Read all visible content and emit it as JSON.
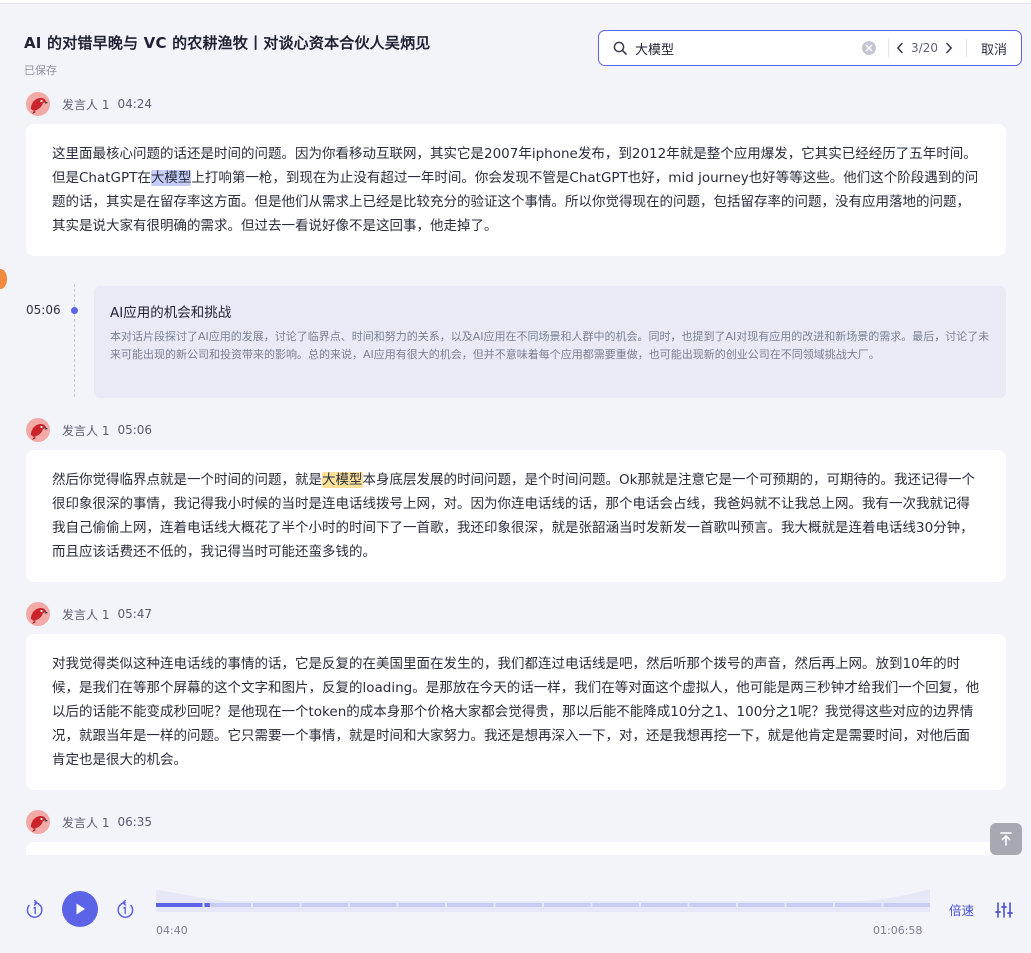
{
  "header": {
    "title": "AI 的对错早晚与 VC 的农耕渔牧丨对谈心资本合伙人吴炳见",
    "saved": "已保存"
  },
  "search": {
    "query": "大模型",
    "counter": "3/20",
    "cancel": "取消"
  },
  "segments": [
    {
      "speaker": "发言人 1",
      "time": "04:24",
      "before": "这里面最核心问题的话还是时间的问题。因为你看移动互联网，其实它是2007年iphone发布，到2012年就是整个应用爆发，它其实已经经历了五年时间。但是ChatGPT在",
      "highlight": "大模型",
      "after": "上打响第一枪，到现在为止没有超过一年时间。你会发现不管是ChatGPT也好，mid journey也好等等这些。他们这个阶段遇到的问题的话，其实是在留存率这方面。但是他们从需求上已经是比较充分的验证这个事情。所以你觉得现在的问题，包括留存率的问题，没有应用落地的问题，其实是说大家有很明确的需求。但过去一看说好像不是这回事，他走掉了。"
    },
    {
      "speaker": "发言人 1",
      "time": "05:06",
      "before": "然后你觉得临界点就是一个时间的问题，就是",
      "highlight": "大模型",
      "after": "本身底层发展的时间问题，是个时间问题。Ok那就是注意它是一个可预期的，可期待的。我还记得一个很印象很深的事情，我记得我小时候的当时是连电话线拨号上网，对。因为你连电话线的话，那个电话会占线，我爸妈就不让我总上网。我有一次我就记得我自己偷偷上网，连着电话线大概花了半个小时的时间下了一首歌，我还印象很深，就是张韶涵当时发新发一首歌叫预言。我大概就是连着电话线30分钟，而且应该话费还不低的，我记得当时可能还蛮多钱的。"
    },
    {
      "speaker": "发言人 1",
      "time": "05:47",
      "text": "对我觉得类似这种连电话线的事情的话，它是反复的在美国里面在发生的，我们都连过电话线是吧，然后听那个拨号的声音，然后再上网。放到10年的时候，是我们在等那个屏幕的这个文字和图片，反复的loading。是那放在今天的话一样，我们在等对面这个虚拟人，他可能是两三秒钟才给我们一个回复，他以后的话能不能变成秒回呢？是他现在一个token的成本身那个价格大家都会觉得贵，那以后能不能降成10分之1、100分之1呢？我觉得这些对应的边界情况，就跟当年是一样的问题。它只需要一个事情，就是时间和大家努力。我还是想再深入一下，对，还是我想再挖一下，就是他肯定是需要时间，对他后面肯定也是很大的机会。"
    },
    {
      "speaker": "发言人 1",
      "time": "06:35"
    }
  ],
  "chapter": {
    "time": "05:06",
    "title": "AI应用的机会和挑战",
    "description": "本对话片段探讨了AI应用的发展，讨论了临界点、时间和努力的关系，以及AI应用在不同场景和人群中的机会。同时，也提到了AI对现有应用的改进和新场景的需求。最后，讨论了未来可能出现的新公司和投资带来的影响。总的来说，AI应用有很大的机会，但并不意味着每个应用都需要重做，也可能出现新的创业公司在不同领域挑战大厂。"
  },
  "player": {
    "current": "04:40",
    "total": "01:06:58",
    "progress": 0.0695,
    "speed": "倍速"
  },
  "colors": {
    "accent": "#5b63e6",
    "highlight_active": "#c5cdf7",
    "highlight": "#fbe19a"
  },
  "icons": [
    "search-icon",
    "clear-icon",
    "chevron-left-icon",
    "chevron-right-icon",
    "avatar-bird-icon",
    "back-to-top-icon",
    "rewind-15-icon",
    "play-icon",
    "forward-15-icon",
    "equalizer-icon"
  ]
}
